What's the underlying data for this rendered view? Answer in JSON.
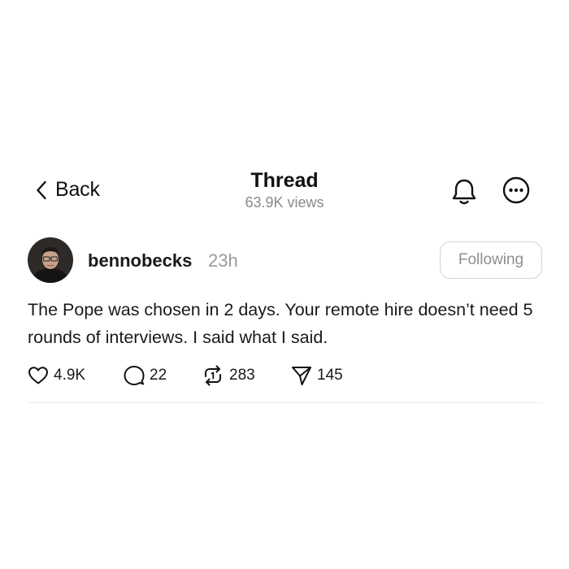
{
  "header": {
    "back_label": "Back",
    "title": "Thread",
    "views": "63.9K views",
    "icons": {
      "back": "chevron-left-icon",
      "notify": "bell-icon",
      "more": "more-icon"
    }
  },
  "post": {
    "username": "bennobecks",
    "time": "23h",
    "follow_label": "Following",
    "text": "The Pope was chosen in 2 days. Your remote hire doesn’t need 5 rounds of interviews. I said what I said.",
    "actions": {
      "likes": "4.9K",
      "comments": "22",
      "reposts": "283",
      "shares": "145"
    }
  },
  "colors": {
    "text": "#111111",
    "muted": "#8a8a8a",
    "button_border": "#d4d4d4",
    "divider": "#ececec"
  }
}
